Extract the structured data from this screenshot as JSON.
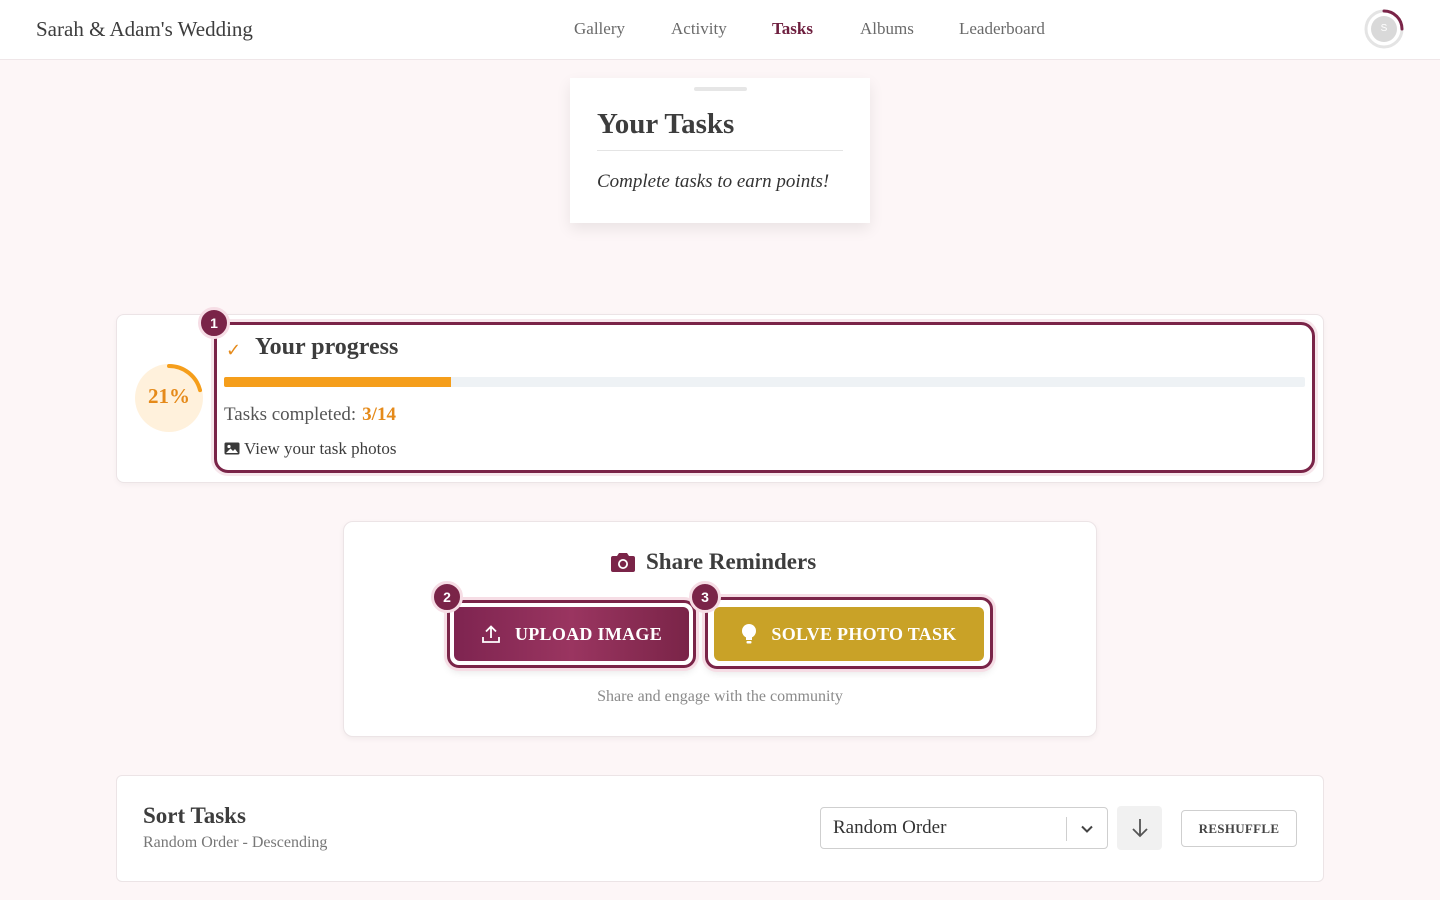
{
  "header": {
    "brand": "Sarah & Adam's Wedding",
    "nav": [
      {
        "label": "Gallery",
        "active": false
      },
      {
        "label": "Activity",
        "active": false
      },
      {
        "label": "Tasks",
        "active": true
      },
      {
        "label": "Albums",
        "active": false
      },
      {
        "label": "Leaderboard",
        "active": false
      }
    ],
    "avatar_initial": "S"
  },
  "title_card": {
    "title": "Your Tasks",
    "subtitle": "Complete tasks to earn points!"
  },
  "progress": {
    "step_badge": "1",
    "percent_label": "21%",
    "percent": 21,
    "title": "Your progress",
    "tasks_label": "Tasks completed:",
    "tasks_count": "3/14",
    "completed": 3,
    "total": 14,
    "view_photos": "View your task photos"
  },
  "share": {
    "title": "Share Reminders",
    "upload": {
      "badge": "2",
      "label": "UPLOAD IMAGE"
    },
    "solve": {
      "badge": "3",
      "label": "SOLVE PHOTO TASK"
    },
    "subtitle": "Share and engage with the community"
  },
  "sort": {
    "title": "Sort Tasks",
    "subtitle": "Random Order - Descending",
    "selected": "Random Order",
    "reshuffle": "RESHUFFLE"
  },
  "colors": {
    "accent": "#7a2448",
    "progress": "#f59e1b",
    "gold": "#c9a227"
  }
}
